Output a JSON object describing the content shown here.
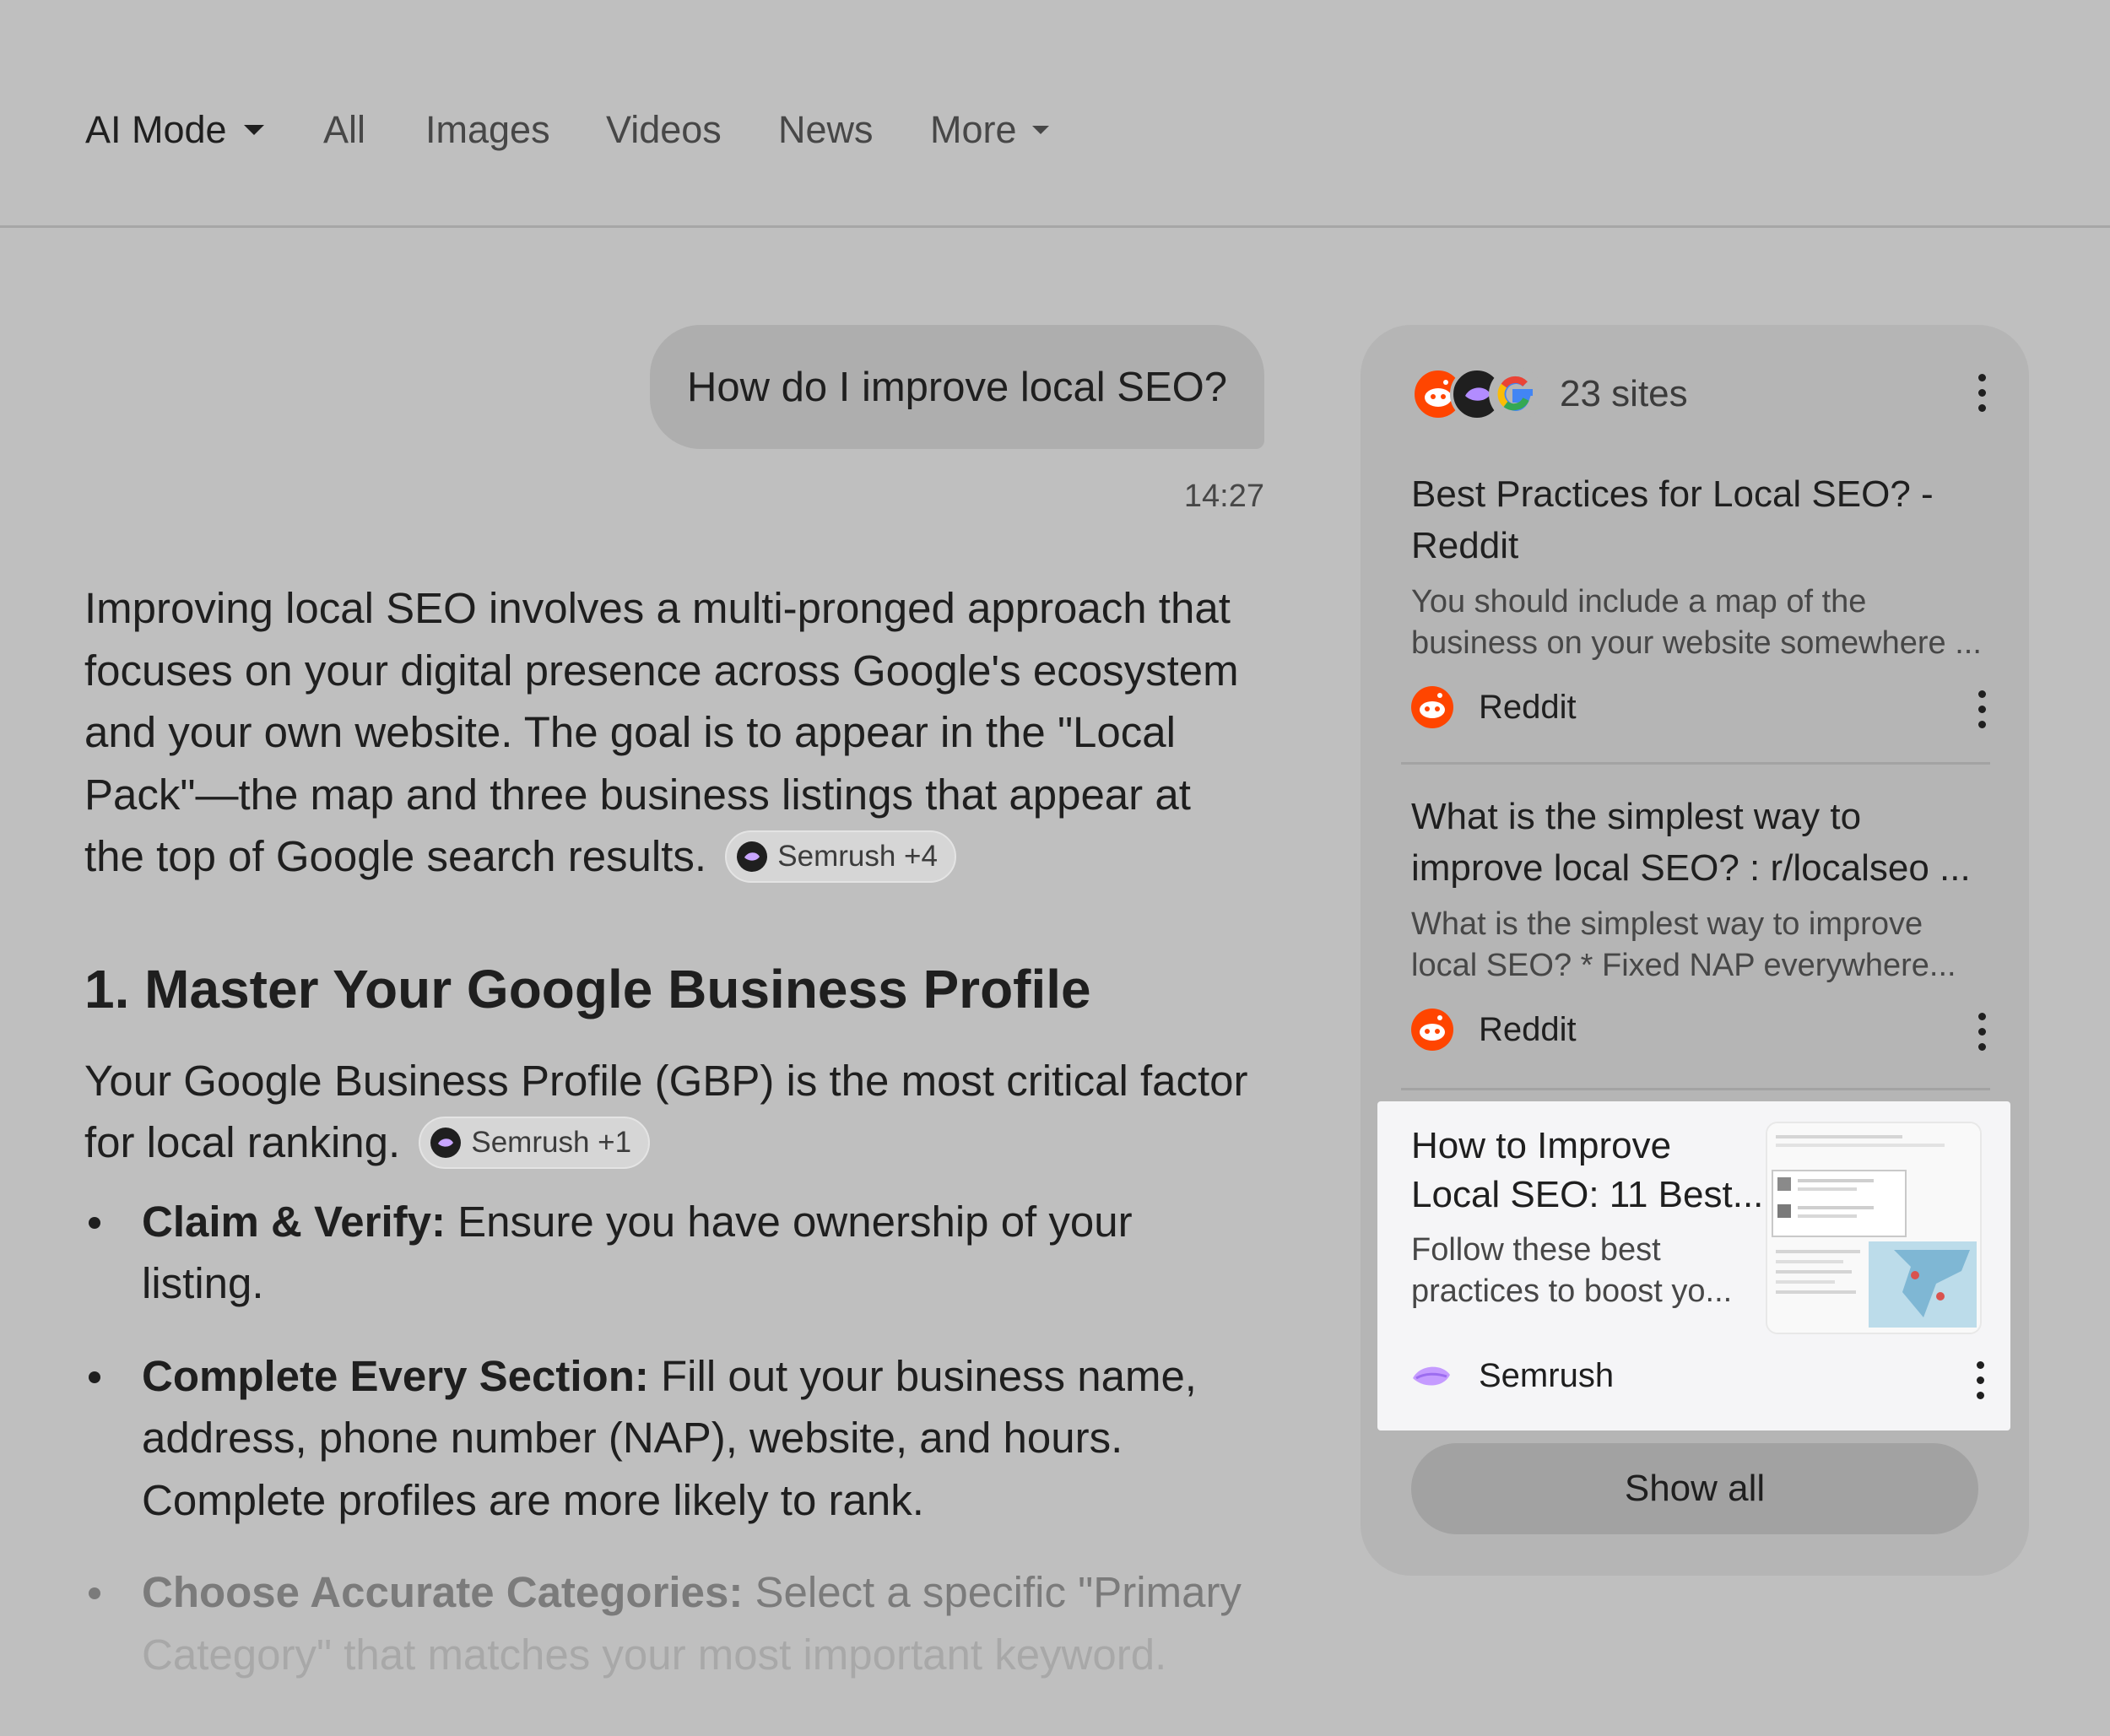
{
  "nav": {
    "tabs": [
      {
        "label": "AI Mode",
        "active": true
      },
      {
        "label": "All"
      },
      {
        "label": "Images"
      },
      {
        "label": "Videos"
      },
      {
        "label": "News"
      },
      {
        "label": "More"
      }
    ]
  },
  "conversation": {
    "query": "How do I improve local SEO?",
    "timestamp": "14:27"
  },
  "answer": {
    "intro": "Improving local SEO involves a multi-pronged approach that focuses on your digital presence across Google's ecosystem and your own website. The goal is to appear in the \"Local Pack\"—the map and three business listings that appear at the top of Google search results.",
    "intro_chip": "Semrush +4",
    "section1_heading": "1. Master Your Google Business Profile",
    "section1_text": "Your Google Business Profile (GBP) is the most critical factor for local ranking.",
    "section1_chip": "Semrush +1",
    "bullets": [
      {
        "bold": "Claim & Verify:",
        "text": " Ensure you have ownership of your listing."
      },
      {
        "bold": "Complete Every Section:",
        "text": " Fill out your business name, address, phone number (NAP), website, and hours. Complete profiles are more likely to rank."
      },
      {
        "bold": "Choose Accurate Categories:",
        "text": " Select a specific \"Primary",
        "text2": "Category\" that matches your most important keyword."
      }
    ]
  },
  "sources": {
    "count_label": "23 sites",
    "items": [
      {
        "title": "Best Practices for Local SEO? - Reddit",
        "snippet": "You should include a map of the business on your website somewhere ...",
        "site": "Reddit"
      },
      {
        "title": "What is the simplest way to improve local SEO? : r/localseo ...",
        "snippet": "What is the simplest way to improve local SEO? * Fixed NAP everywhere...",
        "site": "Reddit"
      },
      {
        "title": "How to Improve Local SEO: 11 Best...",
        "snippet": "Follow these best practices to boost yo...",
        "site": "Semrush"
      }
    ],
    "show_all_label": "Show all"
  },
  "colors": {
    "reddit": "#ff4500",
    "semrush": "#b28cff",
    "background": "#bfbfbf"
  }
}
